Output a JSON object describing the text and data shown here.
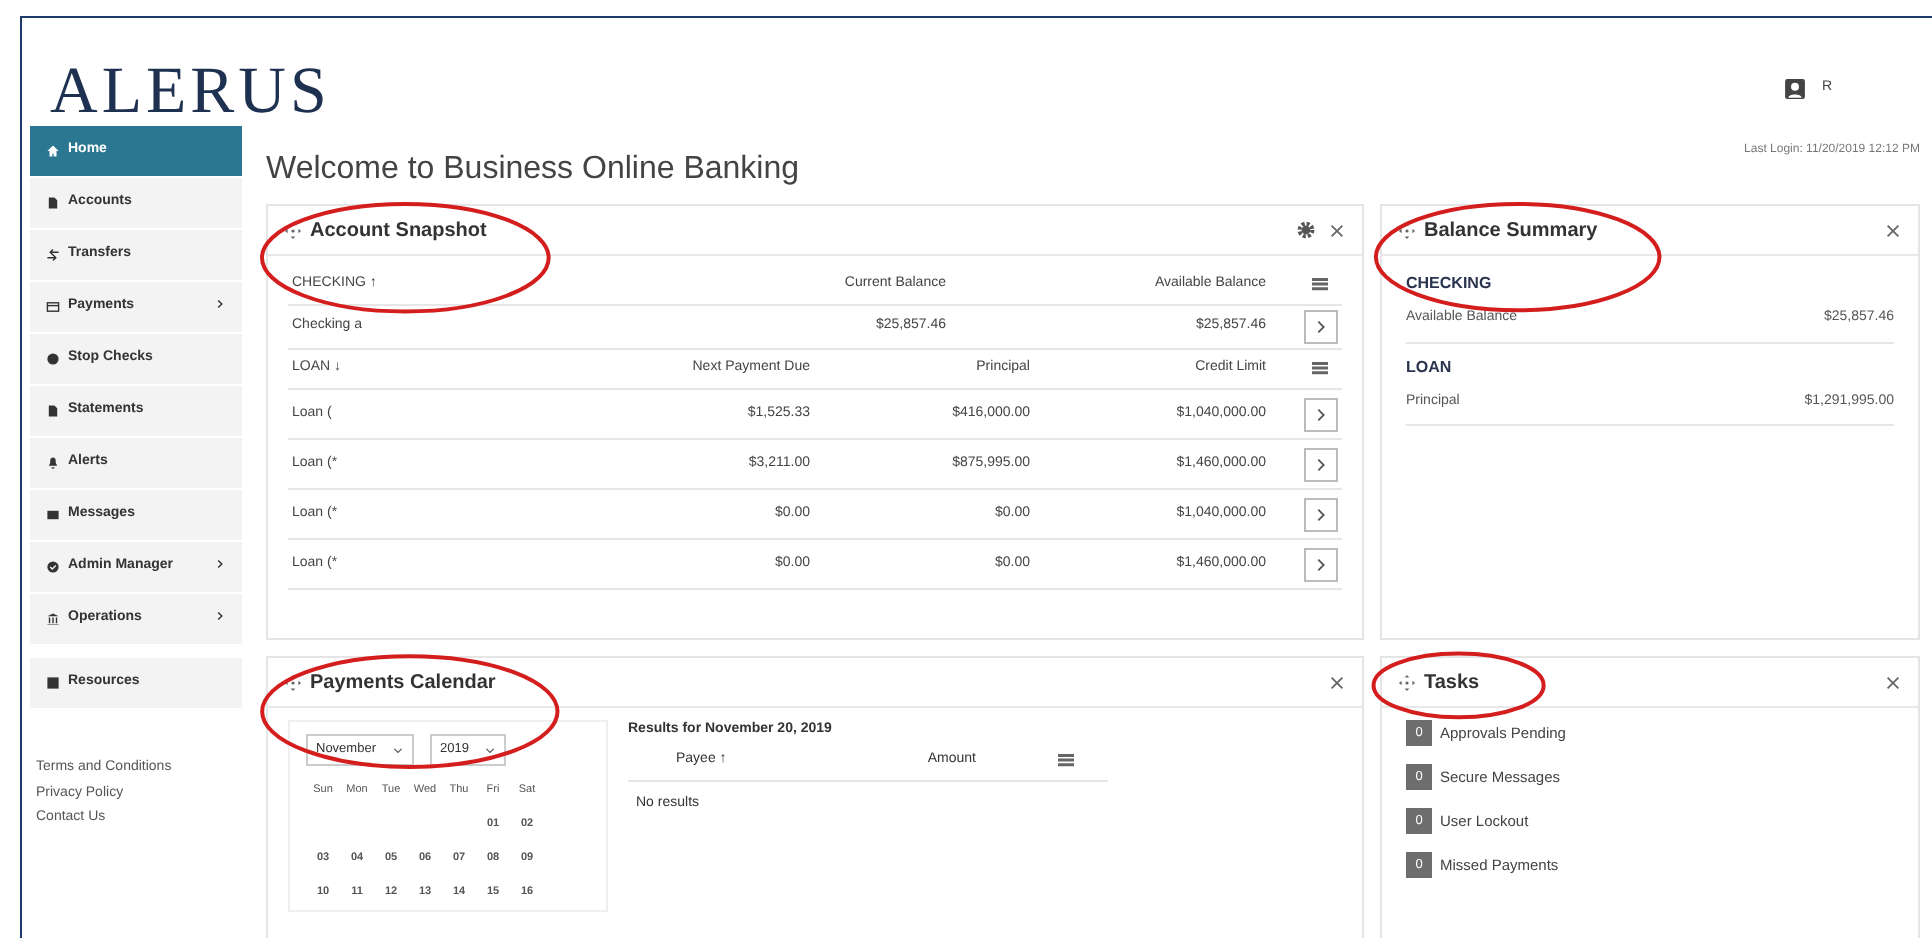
{
  "logo": "ALERUS",
  "header": {
    "user_initial": "R"
  },
  "sidebar": {
    "items": [
      {
        "label": "Home",
        "selected": true,
        "expandable": false
      },
      {
        "label": "Accounts",
        "selected": false,
        "expandable": false
      },
      {
        "label": "Transfers",
        "selected": false,
        "expandable": false
      },
      {
        "label": "Payments",
        "selected": false,
        "expandable": true
      },
      {
        "label": "Stop Checks",
        "selected": false,
        "expandable": false
      },
      {
        "label": "Statements",
        "selected": false,
        "expandable": false
      },
      {
        "label": "Alerts",
        "selected": false,
        "expandable": false
      },
      {
        "label": "Messages",
        "selected": false,
        "expandable": false
      },
      {
        "label": "Admin Manager",
        "selected": false,
        "expandable": true
      },
      {
        "label": "Operations",
        "selected": false,
        "expandable": true
      },
      {
        "label": "Resources",
        "selected": false,
        "expandable": false
      }
    ],
    "links": [
      "Terms and Conditions",
      "Privacy Policy",
      "Contact Us"
    ]
  },
  "page": {
    "title": "Welcome to Business Online Banking",
    "last_login": "Last Login: 11/20/2019 12:12 PM"
  },
  "account_snapshot": {
    "title": "Account Snapshot",
    "circled": true,
    "checking": {
      "columns": [
        "CHECKING ↑",
        "Current Balance",
        "Available Balance"
      ],
      "rows": [
        [
          "Checking a",
          "$25,857.46",
          "$25,857.46"
        ]
      ]
    },
    "loan": {
      "columns": [
        "LOAN ↓",
        "Next Payment Due",
        "Principal",
        "Credit Limit"
      ],
      "rows": [
        [
          "Loan (",
          "$1,525.33",
          "$416,000.00",
          "$1,040,000.00"
        ],
        [
          "Loan (*",
          "$3,211.00",
          "$875,995.00",
          "$1,460,000.00"
        ],
        [
          "Loan (*",
          "$0.00",
          "$0.00",
          "$1,040,000.00"
        ],
        [
          "Loan (*",
          "$0.00",
          "$0.00",
          "$1,460,000.00"
        ]
      ]
    }
  },
  "balance_summary": {
    "title": "Balance Summary",
    "circled": true,
    "groups": [
      {
        "heading": "CHECKING",
        "label": "Available Balance",
        "value": "$25,857.46"
      },
      {
        "heading": "LOAN",
        "label": "Principal",
        "value": "$1,291,995.00"
      }
    ]
  },
  "payments_calendar": {
    "title": "Payments Calendar",
    "circled": true,
    "month": "November",
    "year": "2019",
    "weekdays": [
      "Sun",
      "Mon",
      "Tue",
      "Wed",
      "Thu",
      "Fri",
      "Sat"
    ],
    "weeks": [
      [
        "01",
        "02"
      ],
      [
        "03",
        "04",
        "05",
        "06",
        "07",
        "08",
        "09"
      ],
      [
        "10",
        "11",
        "12",
        "13",
        "14",
        "15",
        "16"
      ]
    ],
    "results_title": "Results for November 20, 2019",
    "columns": [
      "Payee ↑",
      "Amount"
    ],
    "empty": "No results"
  },
  "tasks": {
    "title": "Tasks",
    "circled": true,
    "items": [
      {
        "count": "0",
        "label": "Approvals Pending"
      },
      {
        "count": "0",
        "label": "Secure Messages"
      },
      {
        "count": "0",
        "label": "User Lockout"
      },
      {
        "count": "0",
        "label": "Missed Payments"
      }
    ]
  }
}
